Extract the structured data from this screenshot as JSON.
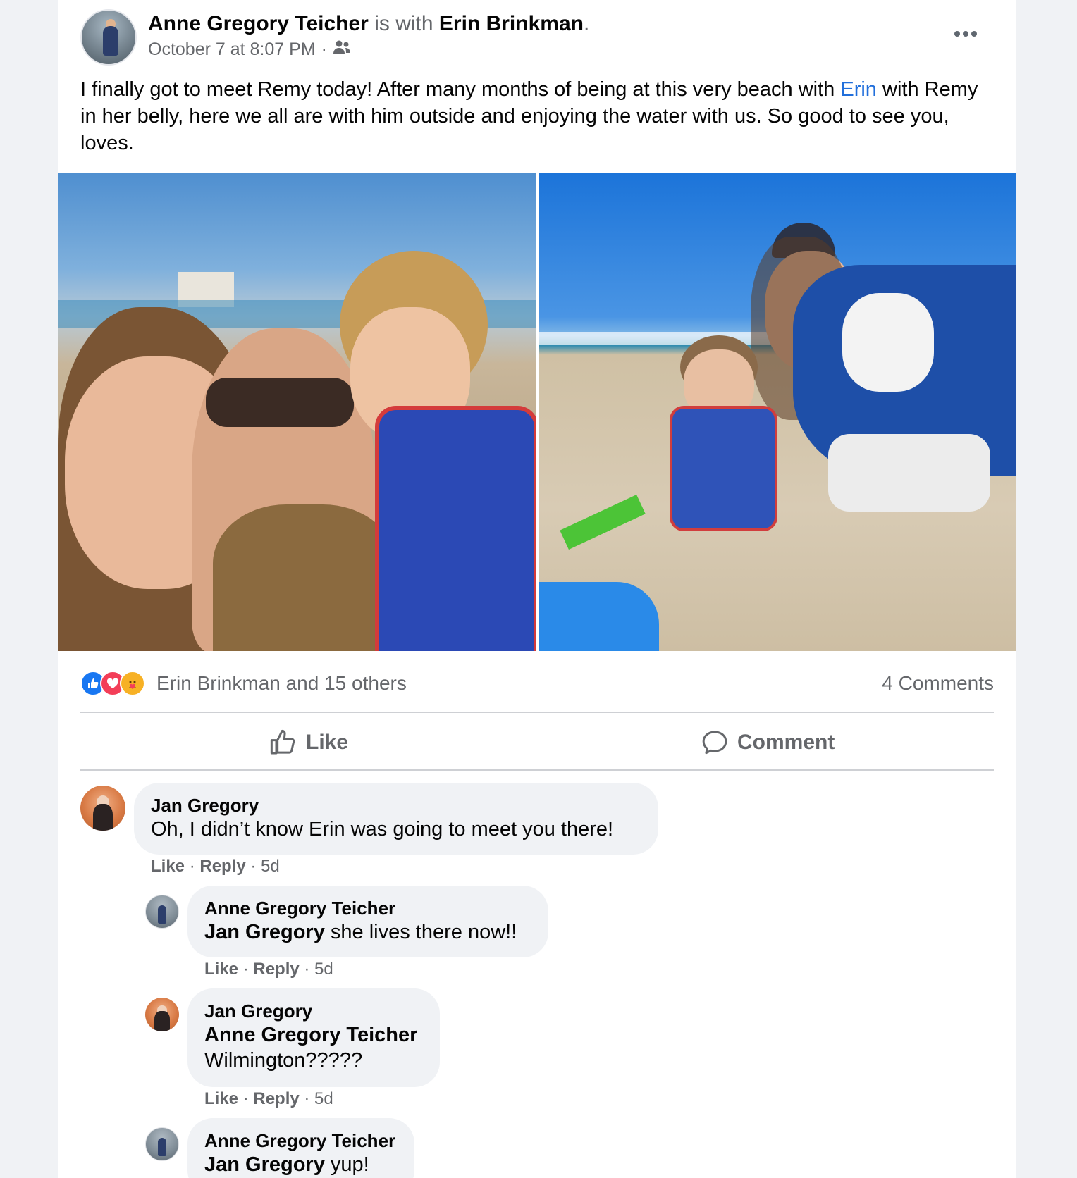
{
  "post": {
    "author": "Anne Gregory Teicher",
    "with_text": " is with ",
    "tagged": "Erin Brinkman",
    "period": ".",
    "timestamp": "October 7 at 8:07 PM",
    "separator": "·",
    "audience_icon": "friends-icon",
    "text_before": "I finally got to meet Remy today! After many months of being at this very beach with ",
    "mention": "Erin",
    "text_after": " with Remy in her belly, here we all are with him outside and enjoying the water with us. So good to see you, loves."
  },
  "reactions": {
    "icons": [
      "like-icon",
      "love-icon",
      "care-icon"
    ],
    "summary": "Erin Brinkman and 15 others",
    "comment_count": "4 Comments"
  },
  "actions": {
    "like": "Like",
    "comment": "Comment"
  },
  "comments": [
    {
      "name": "Jan Gregory",
      "mention": "",
      "text": "Oh, I didn’t know Erin was going to meet you there!",
      "like": "Like",
      "reply": "Reply",
      "age": "5d"
    },
    {
      "name": "Anne Gregory Teicher",
      "mention": "Jan Gregory",
      "text": " she lives there now!!",
      "like": "Like",
      "reply": "Reply",
      "age": "5d"
    },
    {
      "name": "Jan Gregory",
      "mention": "Anne Gregory Teicher",
      "text": "Wilmington?????",
      "like": "Like",
      "reply": "Reply",
      "age": "5d"
    },
    {
      "name": "Anne Gregory Teicher",
      "mention": "Jan Gregory",
      "text": " yup!"
    }
  ],
  "colors": {
    "accent": "#216fdb",
    "like": "#1877f2",
    "love": "#f33e58",
    "care": "#f7b125",
    "secondary_text": "#65676b"
  }
}
